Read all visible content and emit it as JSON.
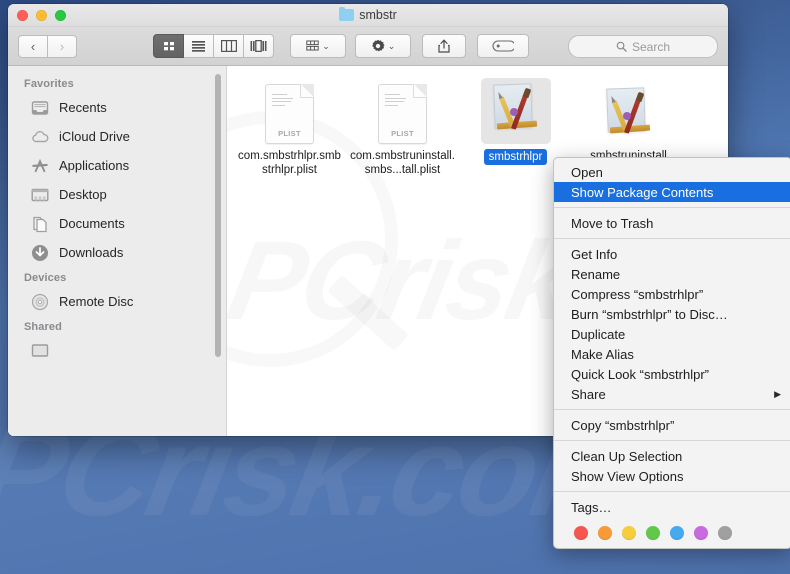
{
  "window": {
    "title": "smbstr",
    "folder_icon": "folder-icon",
    "traffic_lights": [
      "close-button",
      "minimize-button",
      "zoom-button"
    ]
  },
  "toolbar": {
    "back_label": "‹",
    "forward_label": "›",
    "view_buttons": [
      {
        "name": "icon-view",
        "active": true
      },
      {
        "name": "list-view",
        "active": false
      },
      {
        "name": "column-view",
        "active": false
      },
      {
        "name": "gallery-view",
        "active": false
      }
    ],
    "arrange_label": "arrange-icon",
    "action_label": "gear-icon",
    "share_label": "share-icon",
    "tags_label": "tag-icon",
    "chevron": "⌄"
  },
  "search": {
    "placeholder": "Search",
    "icon": "search-icon"
  },
  "sidebar": {
    "sections": [
      {
        "header": "Favorites",
        "items": [
          {
            "label": "Recents",
            "icon": "recents-icon"
          },
          {
            "label": "iCloud Drive",
            "icon": "cloud-icon"
          },
          {
            "label": "Applications",
            "icon": "applications-icon"
          },
          {
            "label": "Desktop",
            "icon": "desktop-icon"
          },
          {
            "label": "Documents",
            "icon": "documents-icon"
          },
          {
            "label": "Downloads",
            "icon": "downloads-icon"
          }
        ]
      },
      {
        "header": "Devices",
        "items": [
          {
            "label": "Remote Disc",
            "icon": "disc-icon"
          }
        ]
      },
      {
        "header": "Shared",
        "items": []
      }
    ]
  },
  "files": [
    {
      "name": "com.smbstrhlpr.smbstrhlpr.plist",
      "kind_badge": "PLIST",
      "type": "plist",
      "selected": false
    },
    {
      "name": "com.smbstruninstall.smbs...tall.plist",
      "kind_badge": "PLIST",
      "type": "plist",
      "selected": false
    },
    {
      "name": "smbstrhlpr",
      "type": "app",
      "selected": true
    },
    {
      "name": "smbstruninstall",
      "type": "app",
      "selected": false
    }
  ],
  "context_menu": {
    "groups": [
      {
        "items": [
          {
            "label": "Open",
            "highlighted": false,
            "submenu": false
          },
          {
            "label": "Show Package Contents",
            "highlighted": true,
            "submenu": false
          }
        ]
      },
      {
        "items": [
          {
            "label": "Move to Trash",
            "highlighted": false,
            "submenu": false
          }
        ]
      },
      {
        "items": [
          {
            "label": "Get Info",
            "highlighted": false,
            "submenu": false
          },
          {
            "label": "Rename",
            "highlighted": false,
            "submenu": false
          },
          {
            "label": "Compress “smbstrhlpr”",
            "highlighted": false,
            "submenu": false
          },
          {
            "label": "Burn “smbstrhlpr” to Disc…",
            "highlighted": false,
            "submenu": false
          },
          {
            "label": "Duplicate",
            "highlighted": false,
            "submenu": false
          },
          {
            "label": "Make Alias",
            "highlighted": false,
            "submenu": false
          },
          {
            "label": "Quick Look “smbstrhlpr”",
            "highlighted": false,
            "submenu": false
          },
          {
            "label": "Share",
            "highlighted": false,
            "submenu": true,
            "arrow": "▶"
          }
        ]
      },
      {
        "items": [
          {
            "label": "Copy “smbstrhlpr”",
            "highlighted": false,
            "submenu": false
          }
        ]
      },
      {
        "items": [
          {
            "label": "Clean Up Selection",
            "highlighted": false,
            "submenu": false
          },
          {
            "label": "Show View Options",
            "highlighted": false,
            "submenu": false
          }
        ]
      },
      {
        "items": [
          {
            "label": "Tags…",
            "highlighted": false,
            "submenu": false
          }
        ]
      }
    ],
    "tag_colors": [
      "#f7554f",
      "#f79a38",
      "#f5ce3f",
      "#62c84c",
      "#46aaf0",
      "#c86ae0",
      "#a0a0a0"
    ],
    "highlight_color": "#1a6fe0"
  },
  "watermark": {
    "desktop_text": "PCrisk.com",
    "content_text": "PCrisk"
  }
}
